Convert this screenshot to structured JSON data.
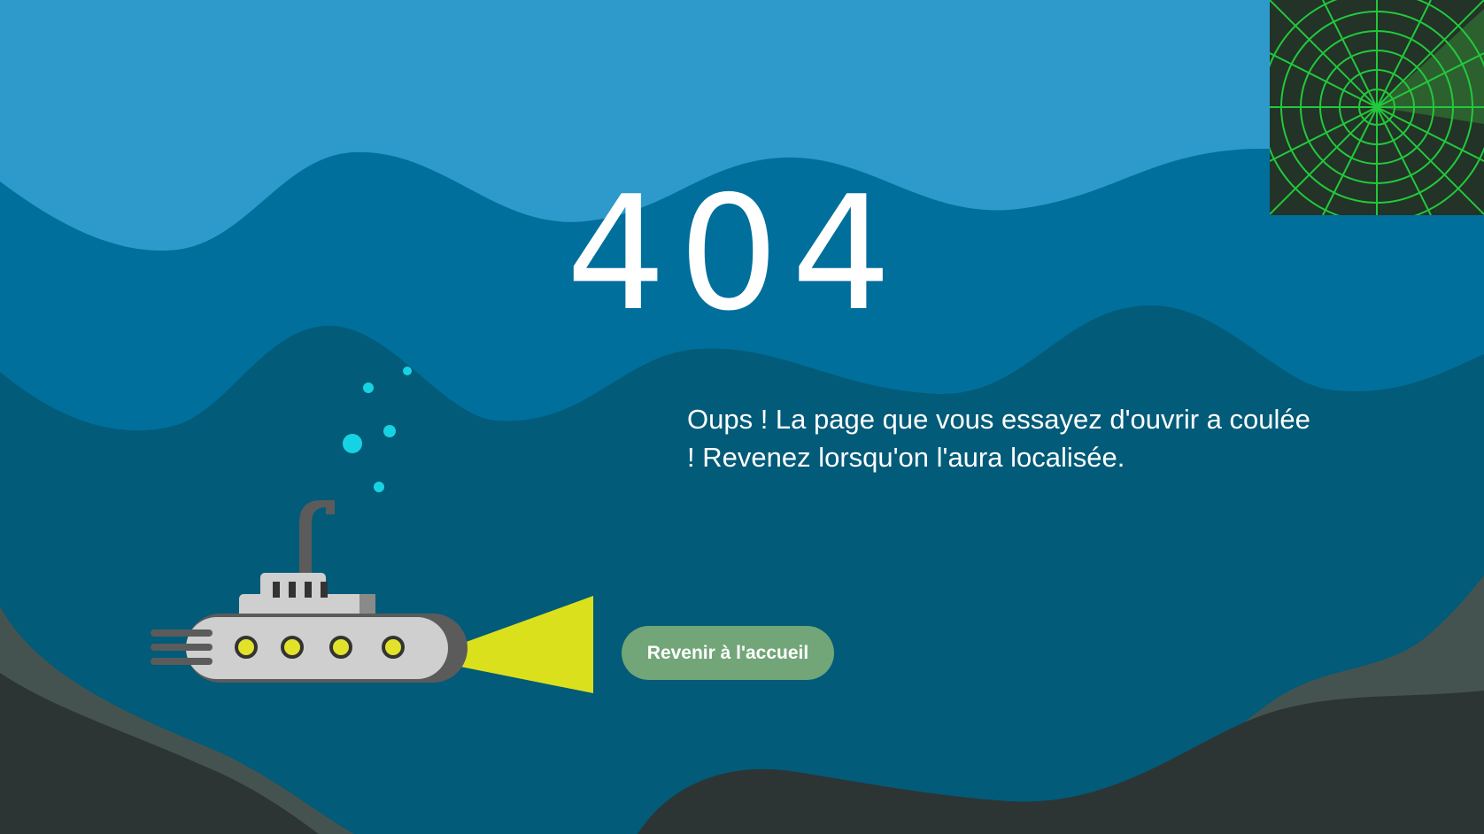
{
  "page": {
    "error_code": "404",
    "message": "Oups ! La page que vous essayez d'ouvrir a coulée ! Revenez lorsqu'on l'aura localisée.",
    "home_button_label": "Revenir à l'accueil"
  },
  "colors": {
    "sky_water": "#2e9acb",
    "mid_water": "#006f9c",
    "deep_water": "#025b78",
    "seabed_light": "#455350",
    "seabed_dark": "#2d3434",
    "button": "#72a678",
    "radar_bg": "#233327",
    "radar_lines": "#22c93c",
    "bubbles": "#16d3e3",
    "light_beam": "#dbe01d",
    "sub_body": "#cfcfcf",
    "sub_dark": "#5b5b5b",
    "portholes": "#e2e22a"
  },
  "icons": {
    "radar": "radar-icon",
    "submarine": "submarine-icon",
    "bubbles": "bubble-icon"
  }
}
